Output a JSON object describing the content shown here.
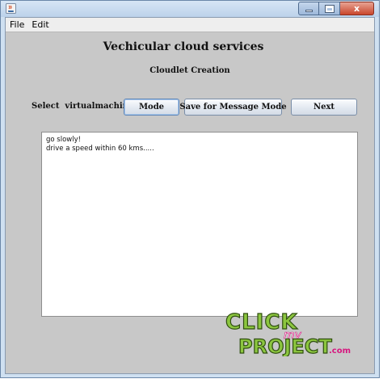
{
  "window": {
    "controls": {
      "minimize_icon": "minimize-icon",
      "maximize_icon": "maximize-icon",
      "close_icon": "close-icon",
      "close_glyph": "x"
    }
  },
  "menu": {
    "items": [
      {
        "label": "File"
      },
      {
        "label": "Edit"
      }
    ]
  },
  "main": {
    "title": "Vechicular cloud services",
    "subtitle": "Cloudlet Creation",
    "select_label": "Select  virtualmachine",
    "buttons": {
      "mode": "Mode",
      "save": "Save for Message Mode",
      "next": "Next"
    },
    "message_text": "go slowly!\ndrive a speed within 60 kms....."
  },
  "watermark": {
    "line1": "CLICK",
    "line2": "my",
    "line3": "PROJECT",
    "suffix": ".com"
  },
  "colors": {
    "window_frame": "#cfe0f1",
    "panel_bg": "#c8c8c8",
    "close_button": "#c9462c",
    "logo_green": "#8cc63f",
    "logo_magenta": "#d6177f"
  }
}
